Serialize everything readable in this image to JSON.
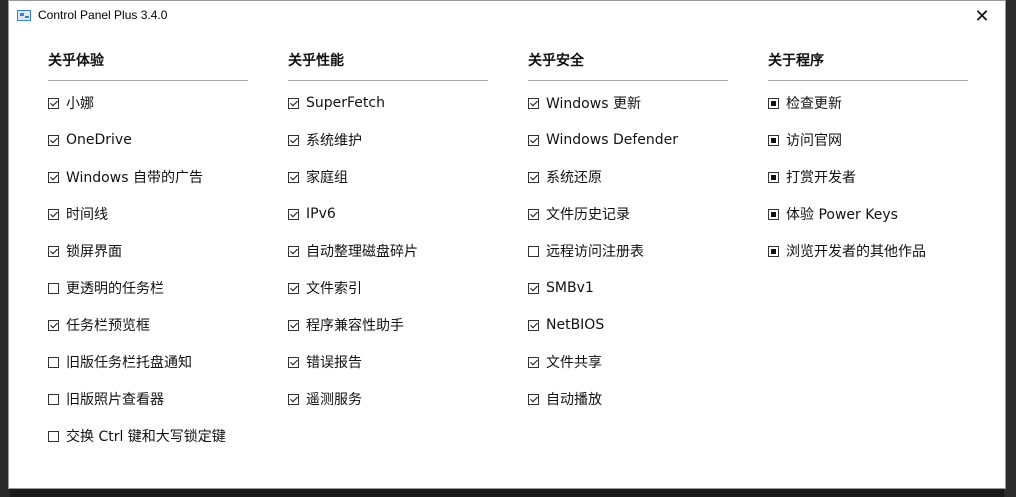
{
  "window": {
    "title": "Control Panel Plus 3.4.0",
    "close_glyph": "✕"
  },
  "columns": [
    {
      "heading": "关乎体验",
      "items": [
        {
          "label": "小娜",
          "state": "checked"
        },
        {
          "label": "OneDrive",
          "state": "checked"
        },
        {
          "label": "Windows 自带的广告",
          "state": "checked"
        },
        {
          "label": "时间线",
          "state": "checked"
        },
        {
          "label": "锁屏界面",
          "state": "checked"
        },
        {
          "label": "更透明的任务栏",
          "state": "unchecked"
        },
        {
          "label": "任务栏预览框",
          "state": "checked"
        },
        {
          "label": "旧版任务栏托盘通知",
          "state": "unchecked"
        },
        {
          "label": "旧版照片查看器",
          "state": "unchecked"
        },
        {
          "label": "交换 Ctrl 键和大写锁定键",
          "state": "unchecked"
        }
      ]
    },
    {
      "heading": "关乎性能",
      "items": [
        {
          "label": "SuperFetch",
          "state": "checked"
        },
        {
          "label": "系统维护",
          "state": "checked"
        },
        {
          "label": "家庭组",
          "state": "checked"
        },
        {
          "label": "IPv6",
          "state": "checked"
        },
        {
          "label": "自动整理磁盘碎片",
          "state": "checked"
        },
        {
          "label": "文件索引",
          "state": "checked"
        },
        {
          "label": "程序兼容性助手",
          "state": "checked"
        },
        {
          "label": "错误报告",
          "state": "checked"
        },
        {
          "label": "遥测服务",
          "state": "checked"
        }
      ]
    },
    {
      "heading": "关乎安全",
      "items": [
        {
          "label": "Windows 更新",
          "state": "checked"
        },
        {
          "label": "Windows Defender",
          "state": "checked"
        },
        {
          "label": "系统还原",
          "state": "checked"
        },
        {
          "label": "文件历史记录",
          "state": "checked"
        },
        {
          "label": "远程访问注册表",
          "state": "unchecked"
        },
        {
          "label": "SMBv1",
          "state": "checked"
        },
        {
          "label": "NetBIOS",
          "state": "checked"
        },
        {
          "label": "文件共享",
          "state": "checked"
        },
        {
          "label": "自动播放",
          "state": "checked"
        }
      ]
    },
    {
      "heading": "关于程序",
      "items": [
        {
          "label": "检查更新",
          "state": "square"
        },
        {
          "label": "访问官网",
          "state": "square"
        },
        {
          "label": "打赏开发者",
          "state": "square"
        },
        {
          "label": "体验 Power Keys",
          "state": "square"
        },
        {
          "label": "浏览开发者的其他作品",
          "state": "square"
        }
      ]
    }
  ]
}
